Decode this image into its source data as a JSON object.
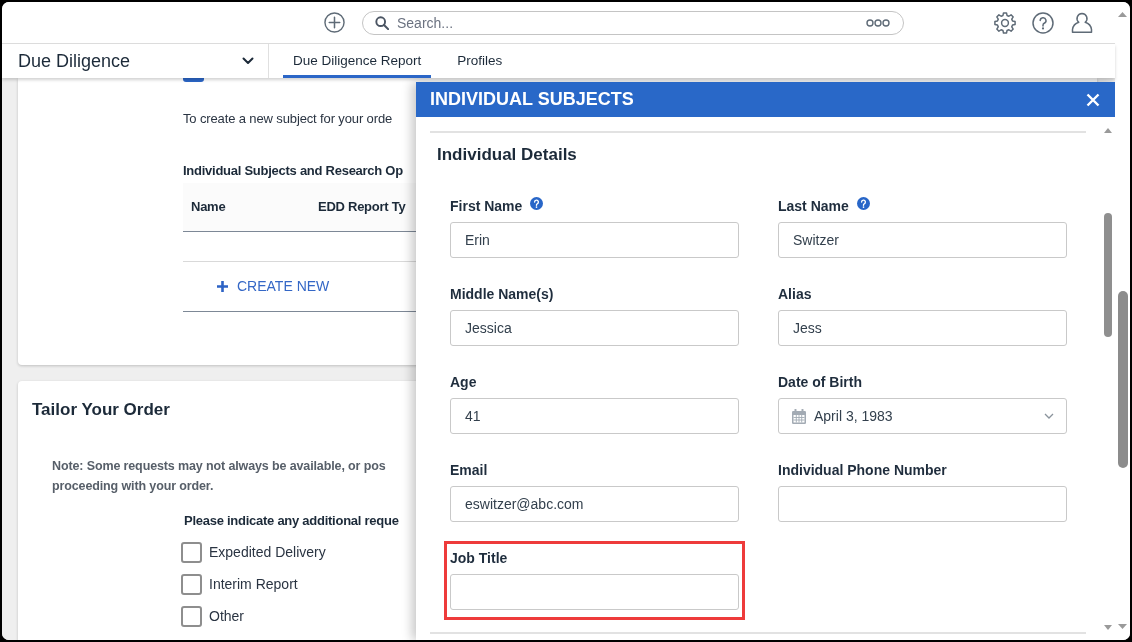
{
  "search": {
    "placeholder": "Search..."
  },
  "nav": {
    "title": "Due Diligence",
    "tabs": [
      {
        "label": "Due Diligence Report",
        "selected": true
      },
      {
        "label": "Profiles",
        "selected": false
      }
    ]
  },
  "subjects_card": {
    "checkbox": {
      "checked": true
    },
    "intro": "To create a new subject for your orde",
    "table_title": "Individual Subjects and Research Op",
    "columns": [
      "Name",
      "EDD Report Ty"
    ],
    "create_button": "CREATE NEW"
  },
  "tailor_card": {
    "title": "Tailor Your Order",
    "note_lines": [
      "Note: Some requests may not always be available, or pos",
      "proceeding with your order."
    ],
    "prompt": "Please indicate any additional reque",
    "options": [
      {
        "label": "Expedited Delivery",
        "checked": false
      },
      {
        "label": "Interim Report",
        "checked": false
      },
      {
        "label": "Other",
        "checked": false
      }
    ]
  },
  "modal": {
    "title": "INDIVIDUAL SUBJECTS",
    "section_title": "Individual Details",
    "fields": [
      {
        "kind": "text",
        "label": "First Name",
        "value": "Erin",
        "help": true,
        "highlighted": false
      },
      {
        "kind": "text",
        "label": "Last Name",
        "value": "Switzer",
        "help": true,
        "highlighted": false
      },
      {
        "kind": "text",
        "label": "Middle Name(s)",
        "value": "Jessica",
        "help": false,
        "highlighted": false
      },
      {
        "kind": "text",
        "label": "Alias",
        "value": "Jess",
        "help": false,
        "highlighted": false
      },
      {
        "kind": "text",
        "label": "Age",
        "value": "41",
        "help": false,
        "highlighted": false
      },
      {
        "kind": "date",
        "label": "Date of Birth",
        "value": "April 3, 1983",
        "help": false,
        "highlighted": false
      },
      {
        "kind": "text",
        "label": "Email",
        "value": "eswitzer@abc.com",
        "help": false,
        "highlighted": false
      },
      {
        "kind": "text",
        "label": "Individual Phone Number",
        "help": false,
        "highlighted": false
      },
      {
        "kind": "text",
        "label": "Job Title",
        "help": false,
        "highlighted": true
      }
    ]
  }
}
